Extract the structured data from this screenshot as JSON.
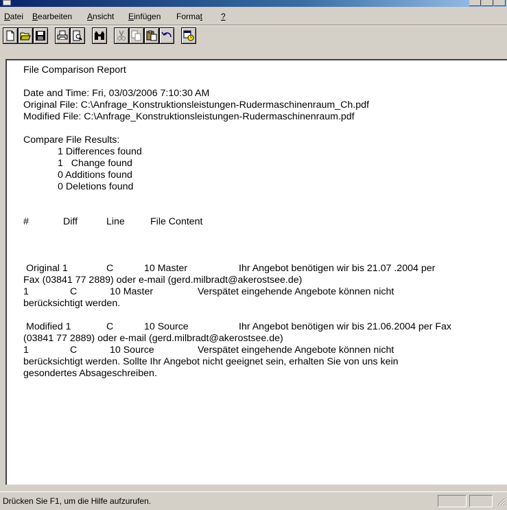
{
  "menu": [
    "Datei",
    "Bearbeiten",
    "Ansicht",
    "Einfügen",
    "Format",
    "?"
  ],
  "toolbar": {
    "icons": [
      "new-document-icon",
      "open-folder-icon",
      "save-icon",
      "print-icon",
      "print-preview-icon",
      "find-icon",
      "cut-icon",
      "copy-icon",
      "paste-icon",
      "undo-icon",
      "date-time-icon"
    ]
  },
  "document": {
    "title": "File Comparison Report",
    "date_time": "Date and Time: Fri, 03/03/2006 7:10:30 AM",
    "original_file": "Original File: C:\\Anfrage_Konstruktionsleistungen-Rudermaschinenraum_Ch.pdf",
    "modified_file": "Modified File: C:\\Anfrage_Konstruktionsleistungen-Rudermaschinenraum.pdf",
    "results_heading": "Compare File Results:",
    "results": [
      "1 Differences found",
      "1   Change found",
      "0 Additions found",
      "0 Deletions found"
    ],
    "columns": [
      "#",
      "Diff",
      "Line",
      "File Content"
    ],
    "original_block": {
      "label": "Original 1",
      "diff": "C",
      "line": "10 Master",
      "content_1": "Ihr Angebot benötigen wir bis 21.07 .2004 per",
      "content_2": "Fax (03841 77 2889) oder e-mail (gerd.milbradt@akerostsee.de)",
      "row2_num": "1",
      "row2_diff": "C",
      "row2_line": "10 Master",
      "row2_content": "Verspätet eingehende Angebote können nicht",
      "row2_cont": "berücksichtigt werden."
    },
    "modified_block": {
      "label": "Modified 1",
      "diff": "C",
      "line": "10 Source",
      "content_1": "Ihr Angebot benötigen wir bis 21.06.2004 per Fax",
      "content_2": "(03841 77 2889) oder e-mail (gerd.milbradt@akerostsee.de)",
      "row2_num": "1",
      "row2_diff": "C",
      "row2_line": "10 Source",
      "row2_content": "Verspätet eingehende Angebote können nicht",
      "row2_cont_1": "berücksichtigt werden. Sollte Ihr Angebot nicht geeignet sein, erhalten Sie von uns kein",
      "row2_cont_2": "gesondertes Absageschreiben."
    }
  },
  "status": {
    "text": "Drücken Sie F1, um die Hilfe aufzurufen."
  }
}
